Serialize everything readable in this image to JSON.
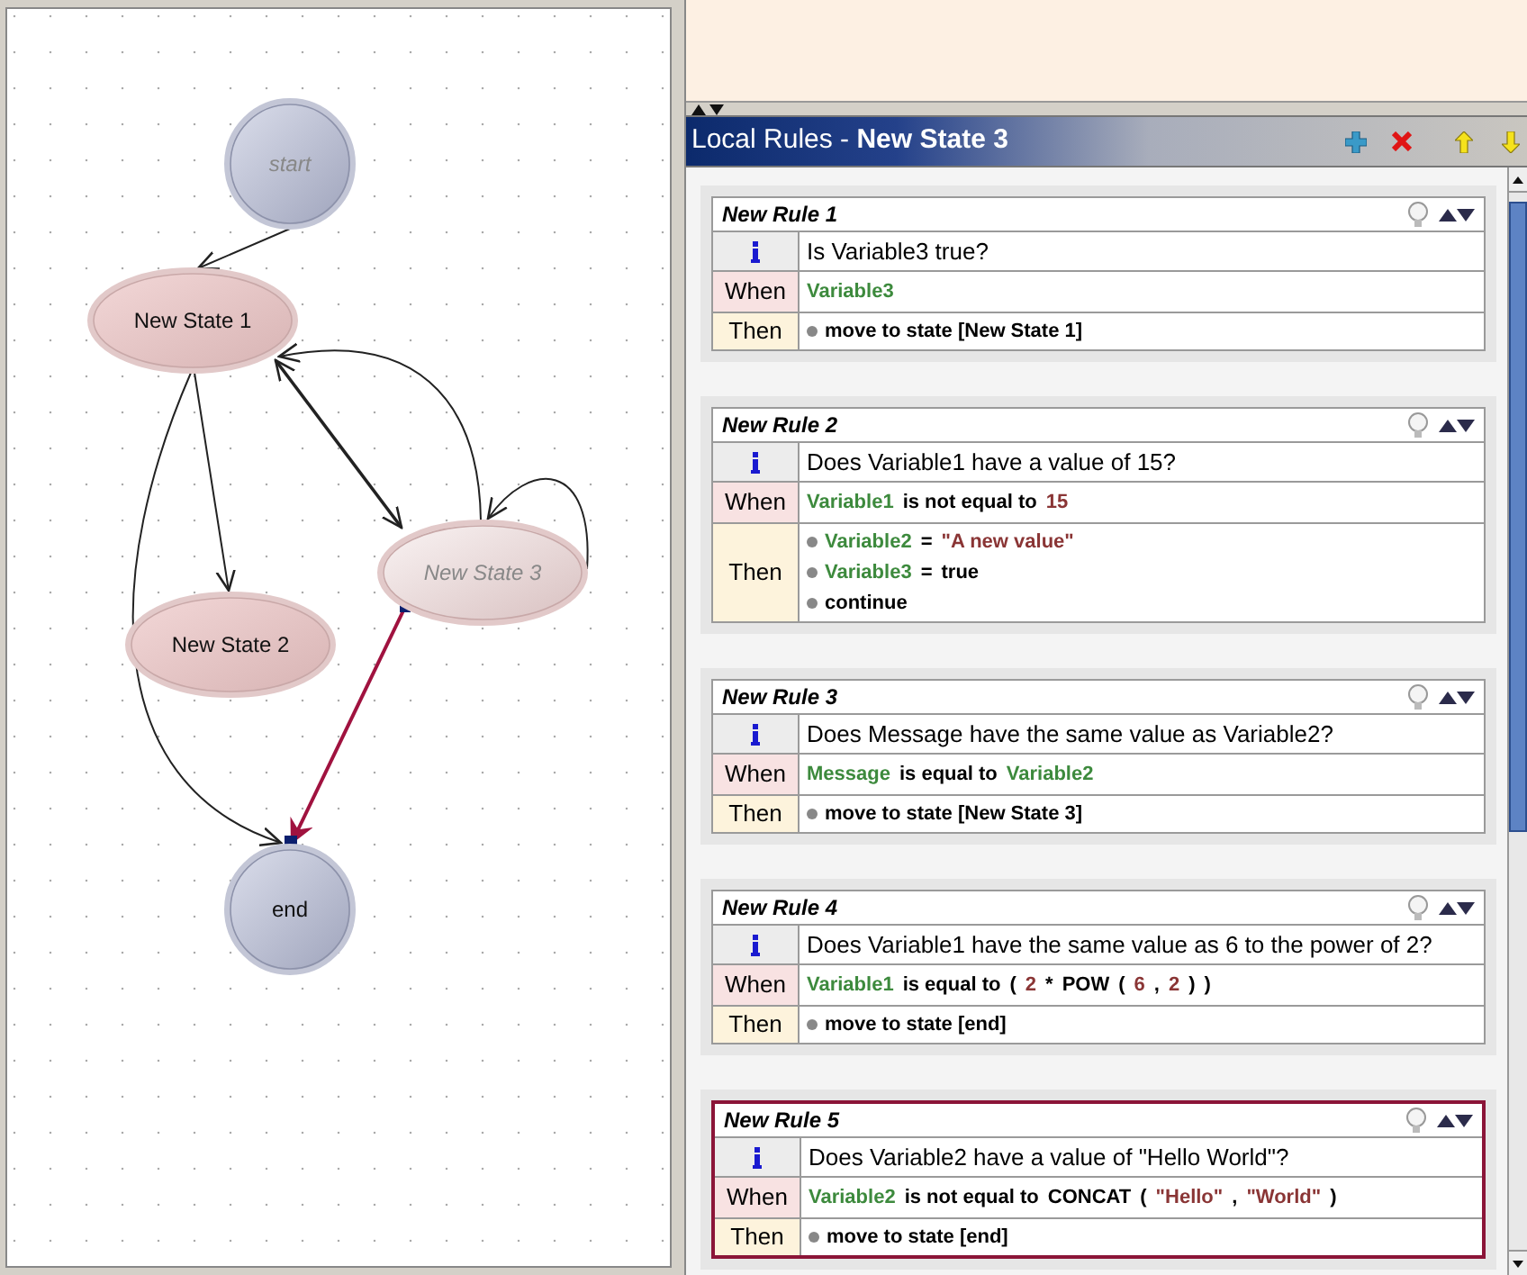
{
  "diagram": {
    "nodes": [
      {
        "label": "start",
        "kind": "initial",
        "selected": false
      },
      {
        "label": "New State 1",
        "kind": "state",
        "selected": false
      },
      {
        "label": "New State 2",
        "kind": "state",
        "selected": false
      },
      {
        "label": "New State 3",
        "kind": "state",
        "selected": true
      },
      {
        "label": "end",
        "kind": "final",
        "selected": false
      }
    ],
    "edges": [
      {
        "selected": false
      },
      {
        "selected": false
      },
      {
        "selected": false
      },
      {
        "selected": false
      },
      {
        "selected": false
      },
      {
        "selected": false
      },
      {
        "selected": true
      }
    ]
  },
  "rules_panel": {
    "title_prefix": "Local Rules - ",
    "state_name": "New State 3",
    "rules": [
      {
        "name": "New Rule 1",
        "selected": false,
        "description": "Is Variable3 true?",
        "when_label": "When",
        "then_label": "Then",
        "when": [
          {
            "kind": "variable",
            "text": "Variable3"
          }
        ],
        "then": [
          [
            {
              "kind": "keyword",
              "text": "move to state [New State 1]"
            }
          ]
        ]
      },
      {
        "name": "New Rule 2",
        "selected": false,
        "description": "Does Variable1 have a value of 15?",
        "when_label": "When",
        "then_label": "Then",
        "when": [
          {
            "kind": "variable",
            "text": "Variable1"
          },
          {
            "kind": "keyword",
            "text": "is not equal to"
          },
          {
            "kind": "value",
            "text": "15"
          }
        ],
        "then": [
          [
            {
              "kind": "variable",
              "text": "Variable2"
            },
            {
              "kind": "keyword",
              "text": "="
            },
            {
              "kind": "value",
              "text": "\"A new value\""
            }
          ],
          [
            {
              "kind": "variable",
              "text": "Variable3"
            },
            {
              "kind": "keyword",
              "text": "="
            },
            {
              "kind": "keyword",
              "text": "true"
            }
          ],
          [
            {
              "kind": "keyword",
              "text": "continue"
            }
          ]
        ]
      },
      {
        "name": "New Rule 3",
        "selected": false,
        "description": "Does Message have the same value as Variable2?",
        "when_label": "When",
        "then_label": "Then",
        "when": [
          {
            "kind": "variable",
            "text": "Message"
          },
          {
            "kind": "keyword",
            "text": "is equal to"
          },
          {
            "kind": "variable",
            "text": "Variable2"
          }
        ],
        "then": [
          [
            {
              "kind": "keyword",
              "text": "move to state [New State 3]"
            }
          ]
        ]
      },
      {
        "name": "New Rule 4",
        "selected": false,
        "description": "Does Variable1 have the same value as 6 to the power of 2?",
        "when_label": "When",
        "then_label": "Then",
        "when": [
          {
            "kind": "variable",
            "text": "Variable1"
          },
          {
            "kind": "keyword",
            "text": "is equal to"
          },
          {
            "kind": "keyword",
            "text": "("
          },
          {
            "kind": "value",
            "text": "2"
          },
          {
            "kind": "keyword",
            "text": "*"
          },
          {
            "kind": "keyword",
            "text": "POW"
          },
          {
            "kind": "keyword",
            "text": "("
          },
          {
            "kind": "value",
            "text": "6"
          },
          {
            "kind": "keyword",
            "text": ","
          },
          {
            "kind": "value",
            "text": "2"
          },
          {
            "kind": "keyword",
            "text": ")"
          },
          {
            "kind": "keyword",
            "text": ")"
          }
        ],
        "then": [
          [
            {
              "kind": "keyword",
              "text": "move to state [end]"
            }
          ]
        ]
      },
      {
        "name": "New Rule 5",
        "selected": true,
        "description": "Does Variable2 have a value of \"Hello World\"?",
        "when_label": "When",
        "then_label": "Then",
        "when": [
          {
            "kind": "variable",
            "text": "Variable2"
          },
          {
            "kind": "keyword",
            "text": "is not equal to"
          },
          {
            "kind": "keyword",
            "text": "CONCAT"
          },
          {
            "kind": "keyword",
            "text": "("
          },
          {
            "kind": "value",
            "text": "\"Hello\""
          },
          {
            "kind": "keyword",
            "text": ","
          },
          {
            "kind": "value",
            "text": "\"World\""
          },
          {
            "kind": "keyword",
            "text": ")"
          }
        ],
        "then": [
          [
            {
              "kind": "keyword",
              "text": "move to state [end]"
            }
          ]
        ]
      }
    ]
  }
}
